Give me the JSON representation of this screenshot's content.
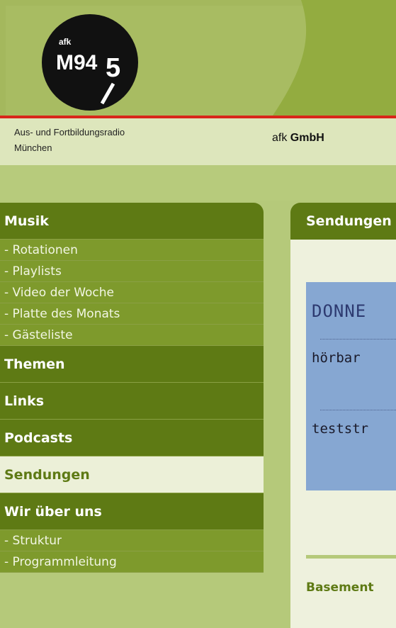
{
  "logo": {
    "small_text": "afk",
    "main_text": "M94",
    "sub_digit": "5"
  },
  "header": {
    "tagline_line1": "Aus- und Fortbildungsradio",
    "tagline_line2": "München",
    "company_prefix": "afk",
    "company_bold": "GmbH"
  },
  "sidebar": {
    "musik": "Musik",
    "rotationen": "- Rotationen",
    "playlists": "- Playlists",
    "video": "- Video der Woche",
    "platte": "- Platte des Monats",
    "gaesteliste": "- Gästeliste",
    "themen": "Themen",
    "links": "Links",
    "podcasts": "Podcasts",
    "sendungen": "Sendungen",
    "wir_ueber_uns": "Wir über uns",
    "struktur": "- Struktur",
    "programmleitung": "- Programmleitung"
  },
  "content": {
    "header_title": "Sendungen",
    "program_day": "DONNE",
    "program_item1": "hörbar",
    "program_item2": "teststr",
    "bottom_title": "Basement"
  },
  "colors": {
    "header_bg": "#a4b85d",
    "accent_red": "#d8261a",
    "nav_dark": "#5e7a14",
    "nav_sub": "#7e9a2c",
    "active_bg": "#ecf0d8",
    "program_box": "#86a7d2"
  }
}
